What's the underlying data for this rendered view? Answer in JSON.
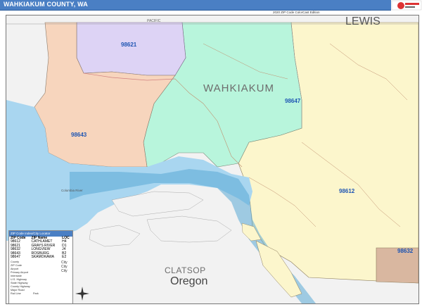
{
  "title": "WAHKIAKUM COUNTY, WA",
  "edition": "2020 ZIP Code ColorCast Edition",
  "labels": {
    "pacific": "PACIFIC",
    "lewis": "LEWIS",
    "wahkiakum": "WAHKIAKUM",
    "clatsop": "CLATSOP",
    "oregon": "Oregon",
    "columbia_river": "Columbia River"
  },
  "zip_labels": [
    "98621",
    "98647",
    "98643",
    "98612",
    "98632"
  ],
  "legend": {
    "header": "ZIP Code Index/City Locator",
    "columns": [
      "ZIP Code",
      "ZIP Name",
      "LOC"
    ],
    "rows": [
      [
        "98612",
        "CATHLAMET",
        "H4"
      ],
      [
        "98621",
        "GRAYS RIVER",
        "D1"
      ],
      [
        "98632",
        "LONGVIEW",
        "J4"
      ],
      [
        "98643",
        "ROSBURG",
        "B2"
      ],
      [
        "98647",
        "SKAMOKAWA",
        "E2"
      ]
    ],
    "symbols": [
      "County",
      "ZIP Code",
      "Airport",
      "Primary Airport",
      "Interstate",
      "U.S. Highway",
      "State Highway",
      "County Highway",
      "Major Road",
      "Rail Line",
      "Park"
    ],
    "city_key": [
      "City",
      "City",
      "City"
    ]
  },
  "colors": {
    "title_bar": "#4a7fc4",
    "zip_98621": "#ddd3f5",
    "zip_98647": "#b8f5dc",
    "zip_98643": "#f7d5bd",
    "zip_98612": "#fcf6cc",
    "zip_98632": "#d9b7a0",
    "water": "#a9d6f0",
    "river": "#5aa9d6",
    "outside": "#f2f2f2"
  }
}
